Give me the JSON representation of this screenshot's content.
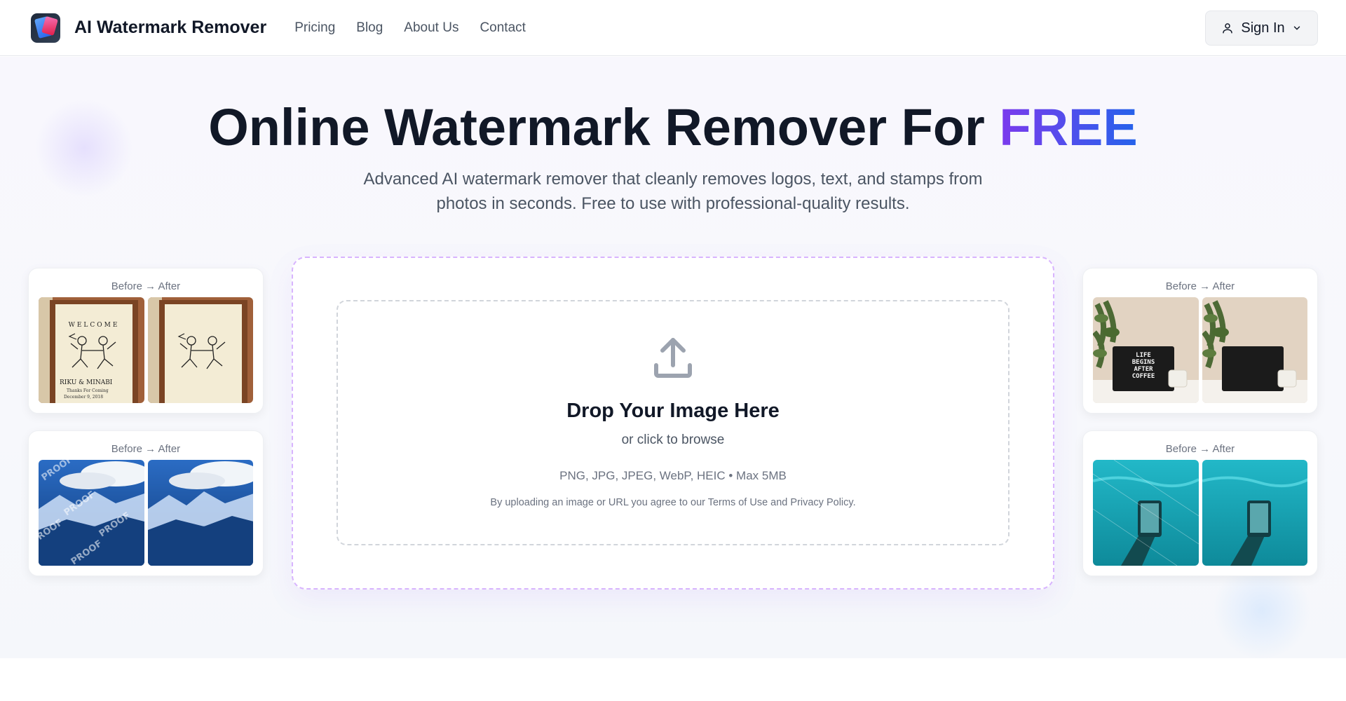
{
  "header": {
    "brand": "AI Watermark Remover",
    "nav": [
      "Pricing",
      "Blog",
      "About Us",
      "Contact"
    ],
    "signin_label": "Sign In"
  },
  "hero": {
    "title_main": "Online Watermark Remover For",
    "title_accent": "FREE",
    "subtitle": "Advanced AI watermark remover that cleanly removes logos, text, and stamps from photos in seconds. Free to use with professional-quality results."
  },
  "upload": {
    "title": "Drop Your Image Here",
    "subtitle": "or click to browse",
    "formats": "PNG, JPG, JPEG, WebP, HEIC • Max 5MB",
    "terms": "By uploading an image or URL you agree to our Terms of Use and Privacy Policy."
  },
  "examples": [
    {
      "label": "Before → After",
      "subject": "welcome sign",
      "watermark_text": [
        "WELCOME",
        "RIKU & MINABI",
        "Thanks For Coming",
        "December 9, 2018"
      ]
    },
    {
      "label": "Before → After",
      "subject": "mountains aerial",
      "watermark_text": "PROOF"
    },
    {
      "label": "Before → After",
      "subject": "letter board",
      "watermark_text": [
        "LIFE",
        "BEGINS",
        "AFTER",
        "COFFEE"
      ]
    },
    {
      "label": "Before → After",
      "subject": "underwater phone",
      "watermark_text": ""
    }
  ],
  "colors": {
    "accent_purple": "#7c3aed",
    "accent_blue": "#2563eb",
    "card_border": "#d8b4fe"
  }
}
